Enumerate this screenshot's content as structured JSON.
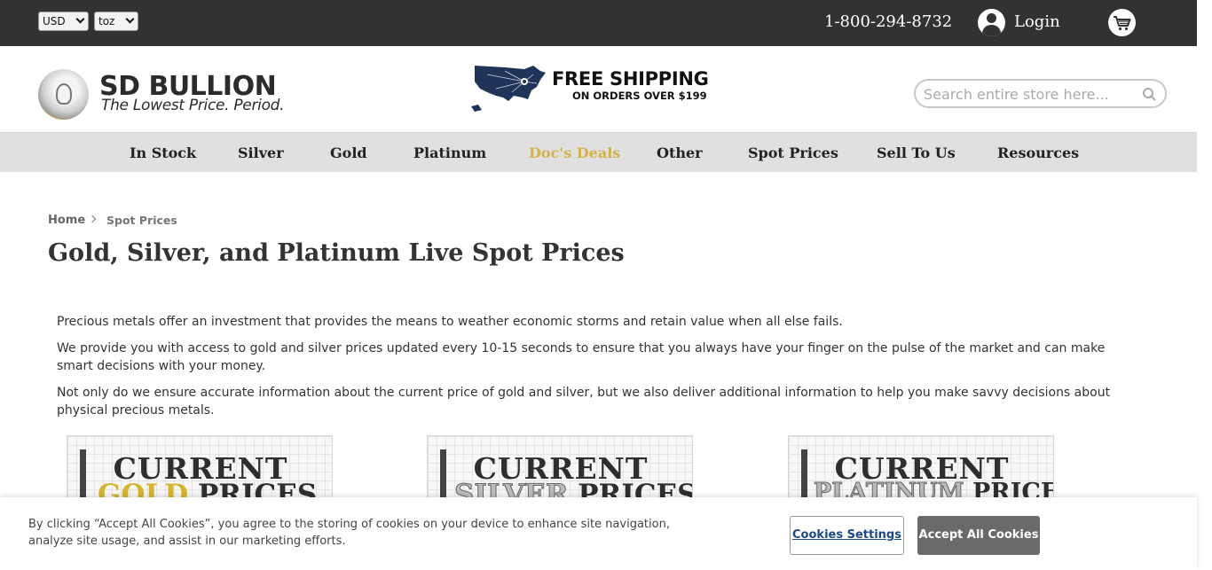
{
  "topbar": {
    "currency": "USD",
    "unit": "toz",
    "phone": "1-800-294-8732",
    "login_label": "Login"
  },
  "header": {
    "logo_title": "SD BULLION",
    "logo_tagline": "The Lowest Price. Period.",
    "shipping_title": "FREE SHIPPING",
    "shipping_subtitle": "ON ORDERS OVER $199",
    "search_placeholder": "Search entire store here..."
  },
  "nav": {
    "items": [
      {
        "label": "In Stock"
      },
      {
        "label": "Silver"
      },
      {
        "label": "Gold"
      },
      {
        "label": "Platinum"
      },
      {
        "label": "Doc's Deals"
      },
      {
        "label": "Other"
      },
      {
        "label": "Spot Prices"
      },
      {
        "label": "Sell To Us"
      },
      {
        "label": "Resources"
      }
    ],
    "highlight_color": "#d2b34a"
  },
  "breadcrumb": {
    "home": "Home",
    "current": "Spot Prices"
  },
  "main": {
    "title": "Gold, Silver, and Platinum Live Spot Prices",
    "paragraphs": [
      "Precious metals offer an investment that provides the means to weather economic storms and retain value when all else fails.",
      "We provide you with access to gold and silver prices updated every 10-15 seconds to ensure that you always have your finger on the pulse of the market and can make smart decisions with your money.",
      "Not only do we ensure accurate information about the current price of gold and silver, but we also deliver additional information to help you make savvy decisions about physical precious metals."
    ],
    "cards": [
      {
        "top": "CURRENT",
        "metal": "GOLD",
        "suffix": "PRICES"
      },
      {
        "top": "CURRENT",
        "metal": "SILVER",
        "suffix": "PRICES"
      },
      {
        "top": "CURRENT",
        "metal": "PLATINUM",
        "suffix": "PRICES"
      }
    ]
  },
  "cookie": {
    "text": "By clicking “Accept All Cookies”, you agree to the storing of cookies on your device to enhance site navigation, analyze site usage, and assist in our marketing efforts.",
    "settings_label": "Cookies Settings",
    "accept_label": "Accept All Cookies"
  }
}
